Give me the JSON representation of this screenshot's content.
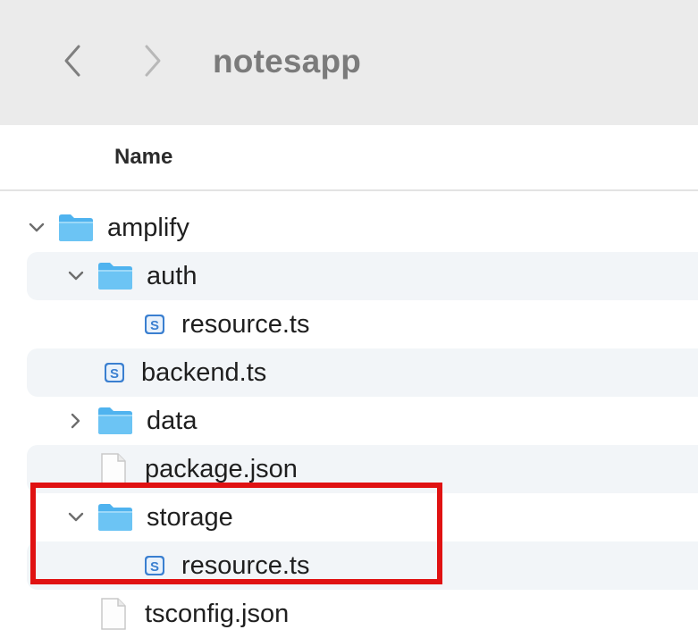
{
  "toolbar": {
    "title": "notesapp",
    "back_icon": "chevron-left-icon",
    "forward_icon": "chevron-right-icon"
  },
  "columns": {
    "name_label": "Name"
  },
  "tree": [
    {
      "label": "amplify",
      "type": "folder",
      "expanded": true,
      "depth": 0
    },
    {
      "label": "auth",
      "type": "folder",
      "expanded": true,
      "depth": 1
    },
    {
      "label": "resource.ts",
      "type": "ts-file",
      "depth": 2
    },
    {
      "label": "backend.ts",
      "type": "ts-file",
      "depth": 1
    },
    {
      "label": "data",
      "type": "folder",
      "expanded": false,
      "depth": 1
    },
    {
      "label": "package.json",
      "type": "file",
      "depth": 1
    },
    {
      "label": "storage",
      "type": "folder",
      "expanded": true,
      "depth": 1,
      "highlighted": true
    },
    {
      "label": "resource.ts",
      "type": "ts-file",
      "depth": 2,
      "highlighted": true
    },
    {
      "label": "tsconfig.json",
      "type": "file",
      "depth": 1
    }
  ],
  "colors": {
    "highlight_border": "#e01212",
    "folder_blue": "#4fb3ef",
    "folder_blue_light": "#8fd1f7",
    "alt_row": "#f2f5f8",
    "toolbar_bg": "#ebebeb"
  }
}
